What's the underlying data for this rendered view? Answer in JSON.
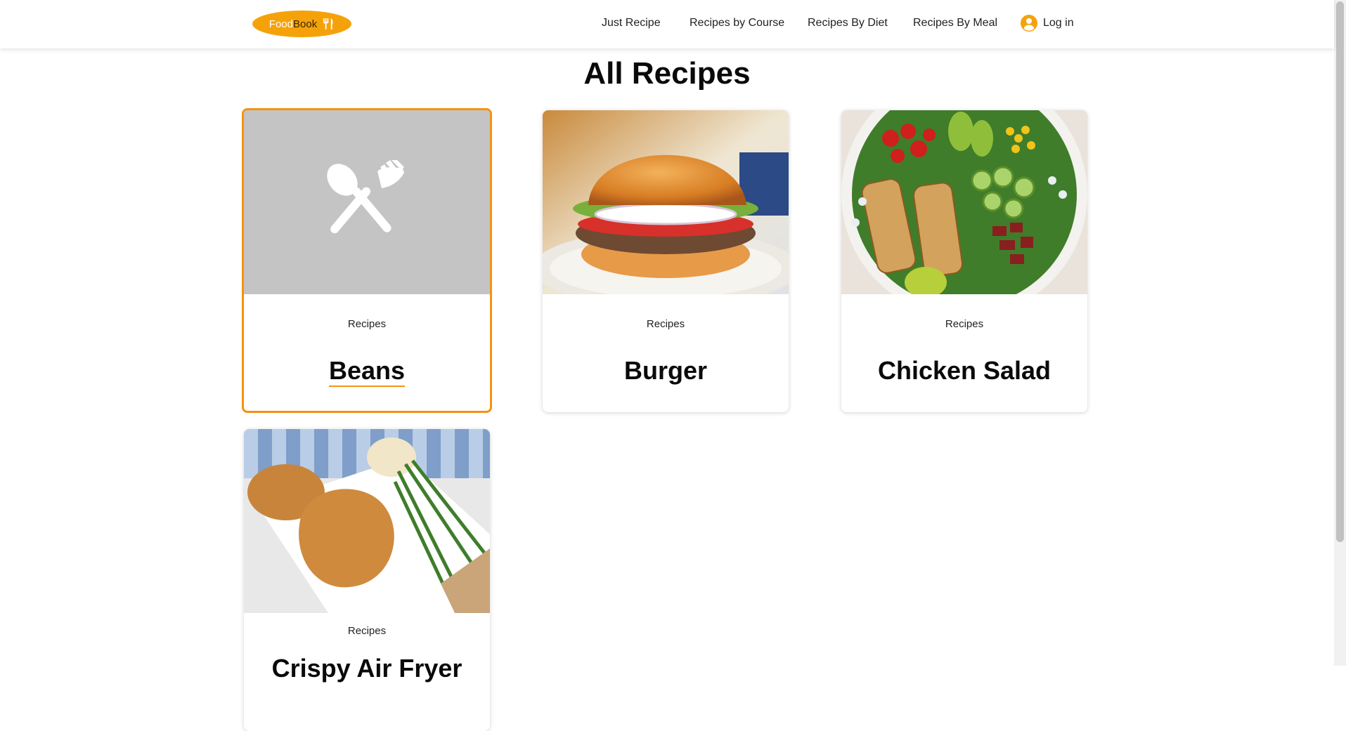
{
  "brand": {
    "part1": "Food",
    "part2": "Book",
    "icon": "fork-knife-icon"
  },
  "nav": {
    "items": [
      "Just Recipe",
      "Recipes by Course",
      "Recipes By Diet",
      "Recipes By Meal"
    ],
    "login": "Log in"
  },
  "page": {
    "title": "All Recipes"
  },
  "cards": [
    {
      "category": "Recipes",
      "title": "Beans",
      "image": "placeholder-utensils-icon"
    },
    {
      "category": "Recipes",
      "title": "Burger",
      "image": "burger-photo"
    },
    {
      "category": "Recipes",
      "title": "Chicken Salad",
      "image": "chicken-salad-photo"
    },
    {
      "category": "Recipes",
      "title": "Crispy Air Fryer",
      "image": "fried-chicken-photo"
    }
  ],
  "colors": {
    "accent": "#f5a20a",
    "active_border": "#f5920f",
    "placeholder": "#c4c4c4"
  }
}
